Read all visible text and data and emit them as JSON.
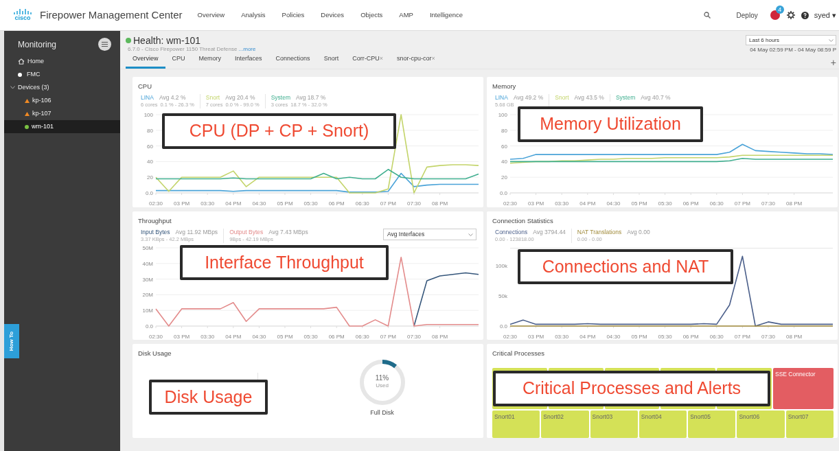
{
  "topbar": {
    "logo_text": "cisco",
    "title": "Firepower Management Center",
    "nav": [
      {
        "label": "Overview"
      },
      {
        "label": "Analysis"
      },
      {
        "label": "Policies"
      },
      {
        "label": "Devices"
      },
      {
        "label": "Objects"
      },
      {
        "label": "AMP"
      },
      {
        "label": "Intelligence"
      }
    ],
    "deploy": "Deploy",
    "alert_badge": "4",
    "user": "syed ▾"
  },
  "sidebar": {
    "title": "Monitoring",
    "items": [
      {
        "label": "Home",
        "kind": "home"
      },
      {
        "label": "FMC",
        "kind": "dot"
      },
      {
        "label": "Devices (3)",
        "kind": "group",
        "expanded": true,
        "children": [
          {
            "label": "kp-106",
            "kind": "warning",
            "selected": false
          },
          {
            "label": "kp-107",
            "kind": "warning",
            "selected": false
          },
          {
            "label": "wm-101",
            "kind": "ok",
            "selected": true
          }
        ]
      }
    ],
    "how_to": "How To"
  },
  "header": {
    "title": "Health: wm-101",
    "subtitle": "6.7.0 - Cisco Firepower 1150 Threat Defense",
    "more": "...more",
    "time_range": "Last 6 hours",
    "time_span": "04 May 02:59 PM - 04 May 08:59 P"
  },
  "tabs": [
    {
      "label": "Overview",
      "selected": true
    },
    {
      "label": "CPU",
      "selected": false
    },
    {
      "label": "Memory",
      "selected": false
    },
    {
      "label": "Interfaces",
      "selected": false
    },
    {
      "label": "Connections",
      "selected": false
    },
    {
      "label": "Snort",
      "selected": false
    },
    {
      "label": "Corr-CPU",
      "selected": false,
      "close": "×"
    },
    {
      "label": "snor-cpu-cor",
      "selected": false,
      "close": "×"
    }
  ],
  "add_tab": "+",
  "cards": [
    {
      "kind": "chart",
      "title": "CPU",
      "legend": [
        {
          "avg": "Avg 4.2 %",
          "detail": "6 cores",
          "range": "0.1 % - 26.3 %"
        },
        {
          "avg": "Avg 20.4 %",
          "detail": "7 cores",
          "range": "0.0 % - 99.0 %"
        },
        {
          "avg": "Avg 18.7 %",
          "detail": "3 cores",
          "range": "18.7 % - 32.0 %"
        }
      ],
      "chart_data": {
        "type": "line",
        "grid": true,
        "categories": [
          "02:30",
          null,
          "03 PM",
          null,
          "03:30",
          null,
          "04 PM",
          null,
          "04:30",
          null,
          "05 PM",
          null,
          "05:30",
          null,
          "06 PM",
          null,
          "06:30",
          null,
          "07 PM",
          null,
          "07:30",
          null,
          "08 PM",
          null,
          null,
          null
        ],
        "ylim": [
          0,
          100
        ],
        "yticks": [
          {
            "value": 0,
            "label": "0.0"
          },
          20,
          40,
          60,
          80,
          100
        ],
        "series": [
          {
            "name": "LINA",
            "color": "#4aa3d8",
            "values": [
              3,
              3,
              3,
              3,
              3,
              3,
              2,
              3,
              3,
              3,
              3,
              3,
              3,
              3,
              3,
              1,
              1,
              1,
              2,
              25,
              8,
              10,
              11,
              11,
              11,
              11
            ]
          },
          {
            "name": "Snort",
            "color": "#c3d46a",
            "values": [
              20,
              2,
              20,
              20,
              20,
              20,
              28,
              8,
              20,
              20,
              20,
              20,
              20,
              20,
              20,
              0,
              0,
              0,
              5,
              100,
              0,
              33,
              35,
              36,
              36,
              35
            ]
          },
          {
            "name": "System",
            "color": "#3fae8f",
            "values": [
              18,
              18,
              18,
              18,
              18,
              18,
              19,
              18,
              18,
              18,
              18,
              18,
              18,
              25,
              18,
              20,
              18,
              18,
              30,
              20,
              18,
              18,
              18,
              18,
              18,
              24
            ]
          }
        ]
      }
    },
    {
      "kind": "chart",
      "title": "Memory",
      "legend": [
        {
          "avg": "Avg 49.2 %",
          "detail": "5.68 GB"
        },
        {
          "avg": "Avg 43.5 %"
        },
        {
          "avg": "Avg 40.7 %"
        }
      ],
      "chart_data": {
        "type": "line",
        "grid": true,
        "categories": [
          "02:30",
          null,
          "03 PM",
          null,
          "03:30",
          null,
          "04 PM",
          null,
          "04:30",
          null,
          "05 PM",
          null,
          "05:30",
          null,
          "06 PM",
          null,
          "06:30",
          null,
          "07 PM",
          null,
          "07:30",
          null,
          "08 PM",
          null,
          null,
          null
        ],
        "ylim": [
          0,
          100
        ],
        "yticks": [
          {
            "value": 0,
            "label": "0.0"
          },
          20,
          40,
          60,
          80,
          100
        ],
        "series": [
          {
            "name": "LINA",
            "color": "#4aa3d8",
            "values": [
              43,
              44,
              49,
              49,
              49,
              49,
              49,
              49,
              49,
              49,
              49,
              49,
              49,
              49,
              49,
              49,
              49,
              52,
              62,
              54,
              53,
              52,
              51,
              50,
              50,
              49
            ]
          },
          {
            "name": "Snort",
            "color": "#c3d46a",
            "values": [
              38,
              39,
              40,
              40,
              41,
              41,
              42,
              43,
              43,
              44,
              44,
              44,
              45,
              45,
              45,
              45,
              45,
              46,
              48,
              48,
              48,
              48,
              48,
              48,
              48,
              48
            ]
          },
          {
            "name": "System",
            "color": "#3fae8f",
            "values": [
              40,
              40,
              40,
              40,
              40,
              40,
              40,
              40,
              40,
              40,
              40,
              40,
              40,
              40,
              40,
              40,
              40,
              41,
              44,
              43,
              43,
              43,
              43,
              43,
              43,
              43
            ]
          }
        ]
      }
    },
    {
      "kind": "chart",
      "title": "Throughput",
      "dropdown": "Avg Interfaces",
      "legend": [
        {
          "avg": "Avg 11.92 MBps",
          "range": "3.37 KBps - 42.2 MBps"
        },
        {
          "avg": "Avg 7.43 MBps",
          "range": "9Bps - 42.19 MBps"
        }
      ],
      "chart_data": {
        "type": "line",
        "grid": true,
        "categories": [
          "02:30",
          null,
          "03 PM",
          null,
          "03:30",
          null,
          "04 PM",
          null,
          "04:30",
          null,
          "05 PM",
          null,
          "05:30",
          null,
          "06 PM",
          null,
          "06:30",
          null,
          "07 PM",
          null,
          "07:30",
          null,
          "08 PM",
          null,
          null,
          null
        ],
        "ylim": [
          0,
          50
        ],
        "yticks": [
          {
            "value": 0,
            "label": "0.0"
          },
          {
            "value": 10,
            "label": "10M"
          },
          {
            "value": 20,
            "label": "20M"
          },
          {
            "value": 30,
            "label": "30M"
          },
          {
            "value": 40,
            "label": "40M"
          },
          {
            "value": 50,
            "label": "50M"
          }
        ],
        "series": [
          {
            "name": "Input Bytes",
            "color": "#34557a",
            "values": [
              null,
              null,
              null,
              null,
              null,
              null,
              null,
              null,
              null,
              null,
              null,
              null,
              null,
              null,
              null,
              null,
              null,
              null,
              null,
              null,
              0,
              29,
              32,
              33,
              34,
              33
            ]
          },
          {
            "name": "Output Bytes",
            "color": "#e38b8b",
            "values": [
              11,
              0,
              11,
              11,
              11,
              11,
              15,
              3,
              11,
              11,
              11,
              11,
              11,
              11,
              12,
              0,
              0,
              4,
              0,
              44,
              0,
              1,
              1,
              1,
              1,
              1
            ]
          }
        ]
      }
    },
    {
      "kind": "chart",
      "title": "Connection Statistics",
      "legend": [
        {
          "avg": "Avg 3794.44",
          "range": "0.00 - 123818.00"
        },
        {
          "avg": "Avg 0.00",
          "range": "0.00 - 0.00"
        }
      ],
      "chart_data": {
        "type": "line",
        "categories": [
          "02:30",
          null,
          "03 PM",
          null,
          "03:30",
          null,
          "04 PM",
          null,
          "04:30",
          null,
          "05 PM",
          null,
          "05:30",
          null,
          "06 PM",
          null,
          "06:30",
          null,
          "07 PM",
          null,
          "07:30",
          null,
          "08 PM",
          null,
          null,
          null
        ],
        "ylim": [
          0,
          130
        ],
        "yticks": [
          {
            "value": 0,
            "label": "0.0"
          },
          {
            "value": 50,
            "label": "50k"
          },
          {
            "value": 100,
            "label": "100k"
          }
        ],
        "series": [
          {
            "name": "Connections",
            "color": "#4b5f8a",
            "values": [
              3,
              10,
              3,
              3,
              3,
              3,
              4,
              3,
              3,
              3,
              3,
              3,
              3,
              3,
              3,
              4,
              3,
              35,
              116,
              0,
              7,
              3,
              3,
              3,
              3,
              3
            ]
          },
          {
            "name": "NAT Translations",
            "color": "#a08a3a",
            "values": [
              0,
              0,
              0,
              0,
              0,
              0,
              0,
              0,
              0,
              0,
              0,
              0,
              0,
              0,
              0,
              0,
              0,
              0,
              0,
              0,
              0,
              0,
              0,
              0,
              0,
              0
            ]
          }
        ]
      }
    },
    {
      "kind": "disk",
      "title": "Disk Usage",
      "level": 0.11,
      "percent": "11%",
      "used": "Used",
      "caption": "Full Disk"
    },
    {
      "kind": "processes",
      "title": "Critical Processes",
      "processes": [
        {
          "name": "SSE Connector",
          "kind": "alert"
        },
        {
          "name": "Snort01",
          "kind": "ok"
        },
        {
          "name": "Snort02",
          "kind": "ok"
        },
        {
          "name": "Snort03",
          "kind": "ok"
        },
        {
          "name": "Snort04",
          "kind": "ok"
        },
        {
          "name": "Snort05",
          "kind": "ok"
        },
        {
          "name": "Snort06",
          "kind": "ok"
        },
        {
          "name": "Snort07",
          "kind": "ok"
        }
      ]
    }
  ],
  "callouts": [
    "CPU (DP + CP + Snort)",
    "Memory Utilization",
    "Interface Throughput",
    "Connections and NAT",
    "Disk Usage",
    "Critical Processes and Alerts"
  ]
}
